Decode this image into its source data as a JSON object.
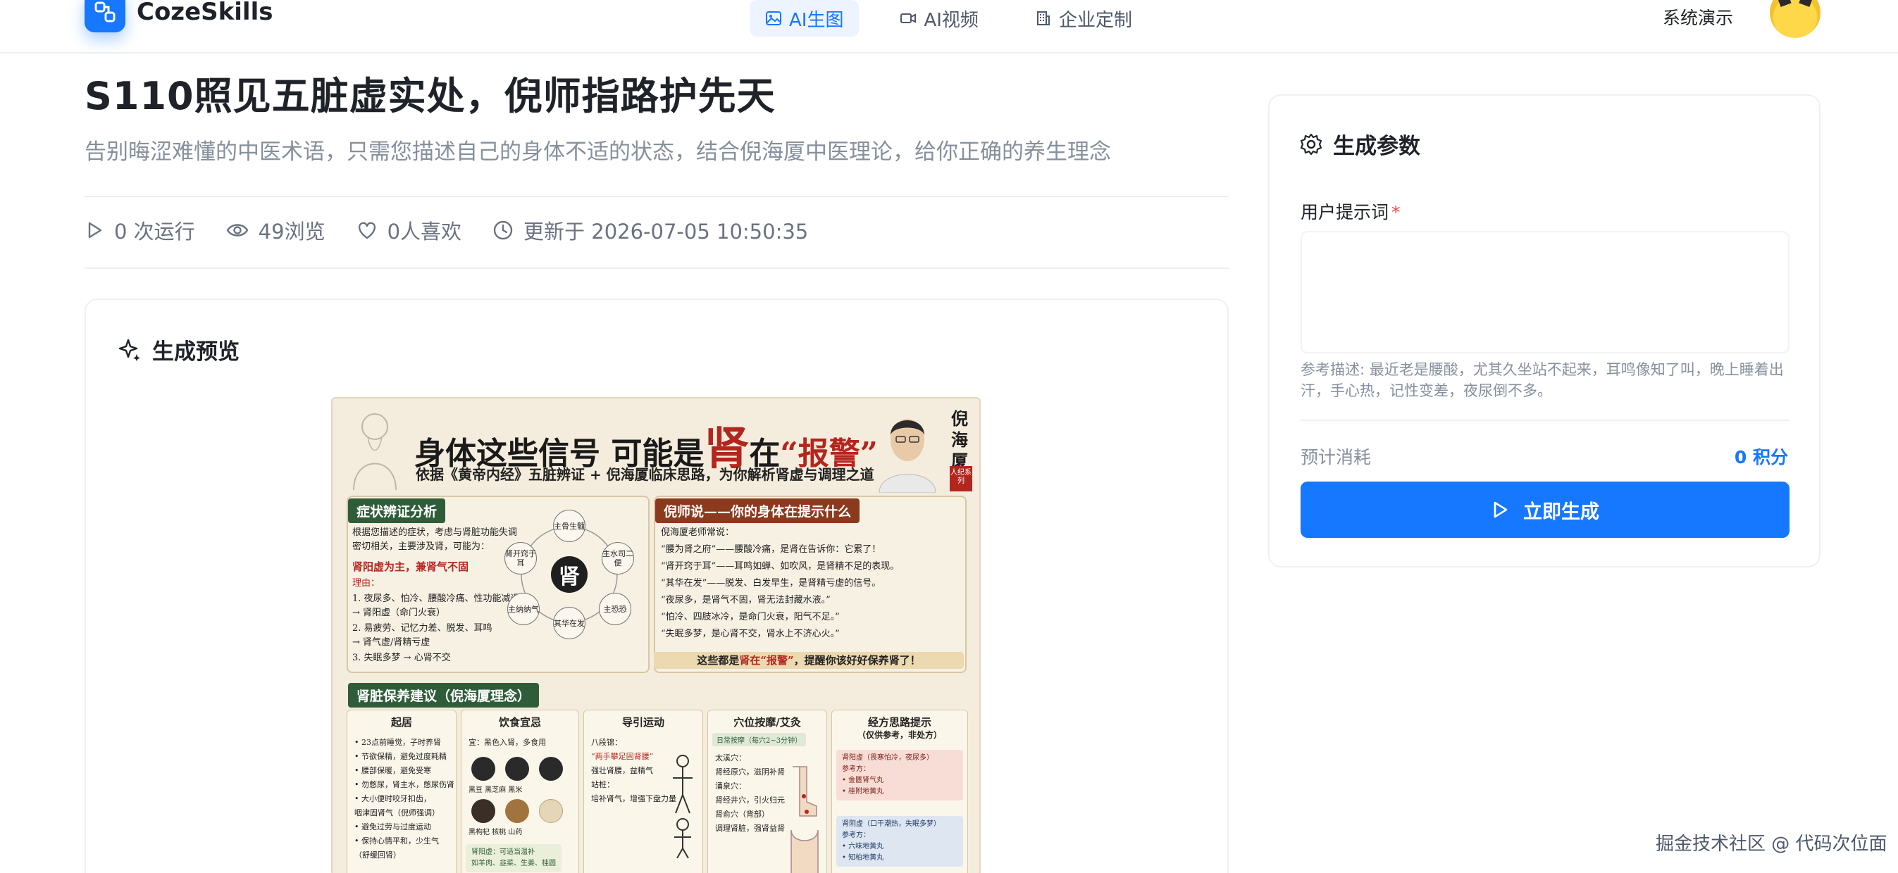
{
  "brand": {
    "name": "CozeSkills"
  },
  "nav": [
    {
      "label": "AI生图",
      "icon": "image-icon",
      "active": true
    },
    {
      "label": "AI视频",
      "icon": "video-icon",
      "active": false
    },
    {
      "label": "企业定制",
      "icon": "building-icon",
      "active": false
    }
  ],
  "user": {
    "label": "系统演示"
  },
  "page": {
    "title": "S110照见五脏虚实处，倪师指路护先天",
    "subtitle": "告别晦涩难懂的中医术语，只需您描述自己的身体不适的状态，结合倪海厦中医理论，给你正确的养生理念"
  },
  "stats": {
    "runs": "0 次运行",
    "views": "49浏览",
    "likes": "0人喜欢",
    "updated": "更新于 2026-07-05 10:50:35"
  },
  "preview": {
    "heading": "生成预览",
    "poster": {
      "headline_a": "身体这些信号 可能是",
      "headline_big": "肾",
      "headline_b": "在",
      "headline_quote": "“报警”",
      "subline": "依据《黄帝内经》五脏辨证 + 倪海厦临床思路，为你解析肾虚与调理之道",
      "name": "倪海厦",
      "seal": "人纪系列",
      "left_tag": "症状辨证分析",
      "left_intro_1": "根据您描述的症状，考虑与肾脏功能失调",
      "left_intro_2": "密切相关，主要涉及肾，可能为：",
      "left_diagnosis": "肾阳虚为主，兼肾气不固",
      "left_reason": "理由：",
      "left_points": [
        "1. 夜尿多、怕冷、腰酸冷痛、性功能减退",
        "   → 肾阳虚（命门火衰）",
        "2. 易疲劳、记忆力差、脱发、耳鸣",
        "   → 肾气虚/肾精亏虚",
        "3. 失眠多梦 → 心肾不交"
      ],
      "diagram_center": "肾",
      "diagram_nodes": [
        "主骨生髓",
        "主水司二便",
        "主恐恐",
        "其华在发",
        "主纳纳气",
        "肾开窍于耳"
      ],
      "right_tag": "倪师说——你的身体在提示什么",
      "right_intro": "倪海厦老师常说：",
      "right_quotes": [
        "“腰为肾之府”——腰酸冷痛，是肾在告诉你：它累了！",
        "“肾开窍于耳”——耳鸣如蝉、如吹风，是肾精不足的表现。",
        "“其华在发”——脱发、白发早生，是肾精亏虚的信号。",
        "“夜尿多，是肾气不固，肾无法封藏水液。”",
        "“怕冷、四肢冰冷，是命门火衰，阳气不足。”",
        "“失眠多梦，是心肾不交，肾水上不济心火。”"
      ],
      "banner_a": "这些都是",
      "banner_red": "肾在“报警”",
      "banner_b": "，提醒你该好好保养肾了！",
      "bottom_tag": "肾脏保养建议（倪海厦理念）",
      "columns": [
        {
          "title": "起居",
          "items": [
            "• 23点前睡觉，子时养肾",
            "• 节欲保精，避免过度耗精",
            "• 腰部保暖，避免受寒",
            "• 勿憋尿，肾主水，憋尿伤肾",
            "• 大小便时咬牙扣齿，",
            "  咽津固肾气（倪师强调）",
            "• 避免过劳与过度运动",
            "• 保持心情平和，少生气",
            "  （舒缓回肾）"
          ]
        },
        {
          "title": "饮食宜忌",
          "items": [
            "宜：黑色入肾，多食用",
            "黑豆   黑芝麻   黑米",
            "黑枸杞  核桃  山药"
          ],
          "note": "肾阳虚：可适当温补",
          "note2": "如羊肉、韭菜、生姜、桂圆"
        },
        {
          "title": "导引运动",
          "items": [
            "八段锦：",
            "“两手攀足固肾腰”",
            "强壮肾腰，益精气",
            "",
            "",
            "站桩：",
            "培补肾气，增强下盘力量"
          ]
        },
        {
          "title": "穴位按摩/艾灸",
          "tag": "日常按摩（每穴2~3分钟）",
          "items": [
            "太溪穴：",
            "肾经原穴，滋阴补肾",
            "",
            "涌泉穴：",
            "肾经井穴，引火归元",
            "",
            "肾俞穴（背部）",
            "调理肾脏，强肾益肾"
          ]
        },
        {
          "title": "经方思路提示",
          "subtitle": "（仅供参考，非处方）",
          "box1": [
            "肾阳虚（畏寒怕冷，夜尿多）",
            "参考方：",
            "• 金匮肾气丸",
            "• 桂附地黄丸"
          ],
          "box2": [
            "肾阴虚（口干潮热，失眠多梦）",
            "参考方：",
            "• 六味地黄丸",
            "• 知柏地黄丸"
          ]
        }
      ]
    }
  },
  "params": {
    "heading": "生成参数",
    "field_label": "用户提示词",
    "required_mark": "*",
    "prompt_value": "",
    "hint": "参考描述: 最近老是腰酸，尤其久坐站不起来，耳鸣像知了叫，晚上睡着出汗，手心热，记性变差，夜尿倒不多。",
    "cost_label": "预计消耗",
    "cost_value": "0 积分",
    "button": "立即生成"
  },
  "watermark": "掘金技术社区 @ 代码次位面",
  "colors": {
    "accent": "#1677ff",
    "required": "#f53f3f",
    "poster_red": "#b3261e",
    "poster_green": "#2f5d3a"
  }
}
